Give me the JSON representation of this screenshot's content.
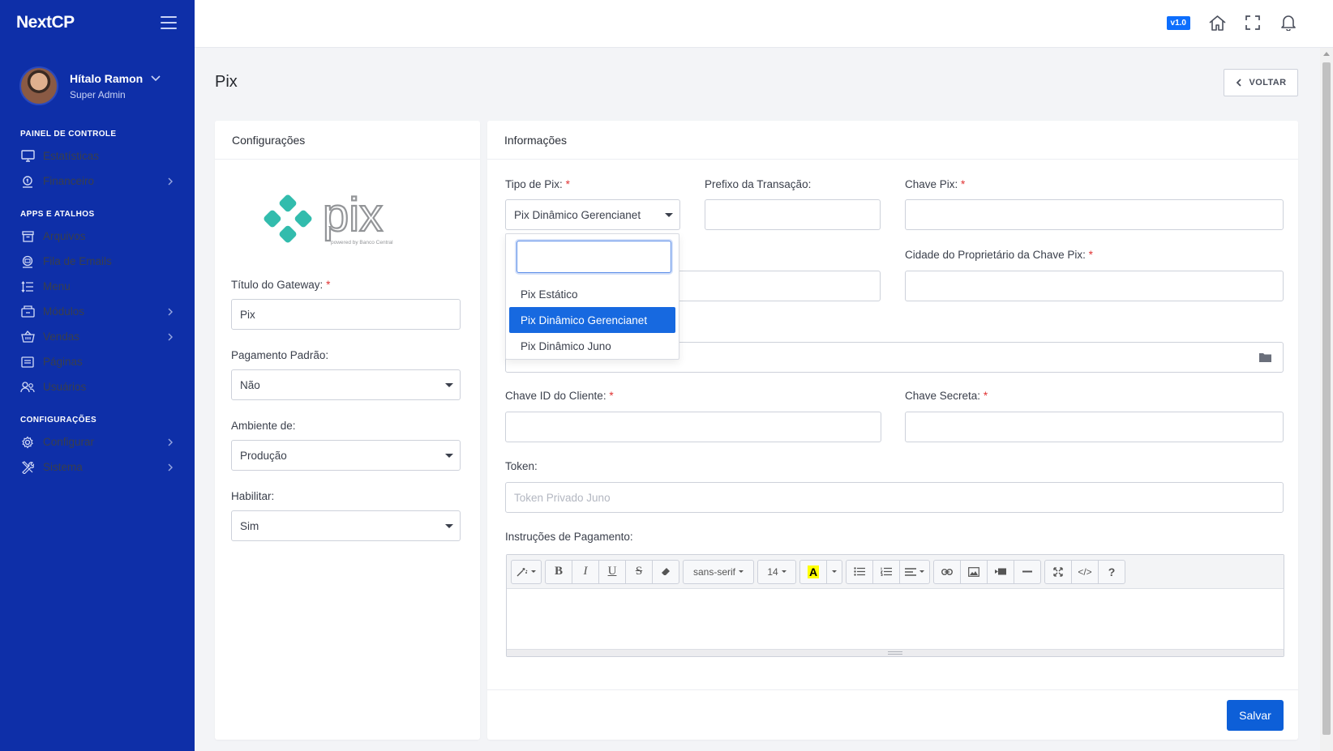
{
  "app": {
    "brand": "NextCP",
    "version": "v1.0"
  },
  "user": {
    "name": "Hítalo Ramon",
    "role": "Super Admin"
  },
  "sidebar": {
    "sections": [
      {
        "title": "PAINEL DE CONTROLE",
        "items": [
          {
            "label": "Estatísticas",
            "icon": "monitor-icon",
            "has_submenu": false
          },
          {
            "label": "Financeiro",
            "icon": "money-icon",
            "has_submenu": true
          }
        ]
      },
      {
        "title": "APPS E ATALHOS",
        "items": [
          {
            "label": "Arquivos",
            "icon": "archive-icon",
            "has_submenu": false
          },
          {
            "label": "Fila de Emails",
            "icon": "email-icon",
            "has_submenu": false
          },
          {
            "label": "Menu",
            "icon": "menu-list-icon",
            "has_submenu": false
          },
          {
            "label": "Módulos",
            "icon": "modules-icon",
            "has_submenu": true
          },
          {
            "label": "Vendas",
            "icon": "basket-icon",
            "has_submenu": true
          },
          {
            "label": "Páginas",
            "icon": "pages-icon",
            "has_submenu": false
          },
          {
            "label": "Usuários",
            "icon": "users-icon",
            "has_submenu": false
          }
        ]
      },
      {
        "title": "CONFIGURAÇÕES",
        "items": [
          {
            "label": "Configurar",
            "icon": "gear-icon",
            "has_submenu": true
          },
          {
            "label": "Sistema",
            "icon": "tools-icon",
            "has_submenu": true
          }
        ]
      }
    ]
  },
  "page": {
    "title": "Pix",
    "back_label": "VOLTAR"
  },
  "config_card": {
    "title": "Configurações",
    "logo_text": "pix",
    "logo_subtext": "powered by Banco Central",
    "gateway_title_label": "Título do Gateway:",
    "gateway_title_value": "Pix",
    "default_payment_label": "Pagamento Padrão:",
    "default_payment_value": "Não",
    "environment_label": "Ambiente de:",
    "environment_value": "Produção",
    "enable_label": "Habilitar:",
    "enable_value": "Sim"
  },
  "info_card": {
    "title": "Informações",
    "pix_type_label": "Tipo de Pix:",
    "pix_type_value": "Pix Dinâmico Gerencianet",
    "pix_type_options": [
      "Pix Estático",
      "Pix Dinâmico Gerencianet",
      "Pix Dinâmico Juno"
    ],
    "pix_type_search": "",
    "prefix_label": "Prefixo da Transação:",
    "prefix_value": "",
    "pix_key_label": "Chave Pix:",
    "pix_key_value": "",
    "city_label": "Cidade do Proprietário da Chave Pix:",
    "city_value": "",
    "client_id_label": "Chave ID do Cliente:",
    "client_id_value": "",
    "secret_key_label": "Chave Secreta:",
    "secret_key_value": "",
    "token_label": "Token:",
    "token_placeholder": "Token Privado Juno",
    "instructions_label": "Instruções de Pagamento:",
    "editor_font": "sans-serif",
    "editor_size": "14",
    "save_label": "Salvar"
  },
  "colors": {
    "sidebar": "#0e2fa8",
    "primary": "#0d5fd8",
    "pix_teal": "#32bcad",
    "required": "#e03232"
  }
}
